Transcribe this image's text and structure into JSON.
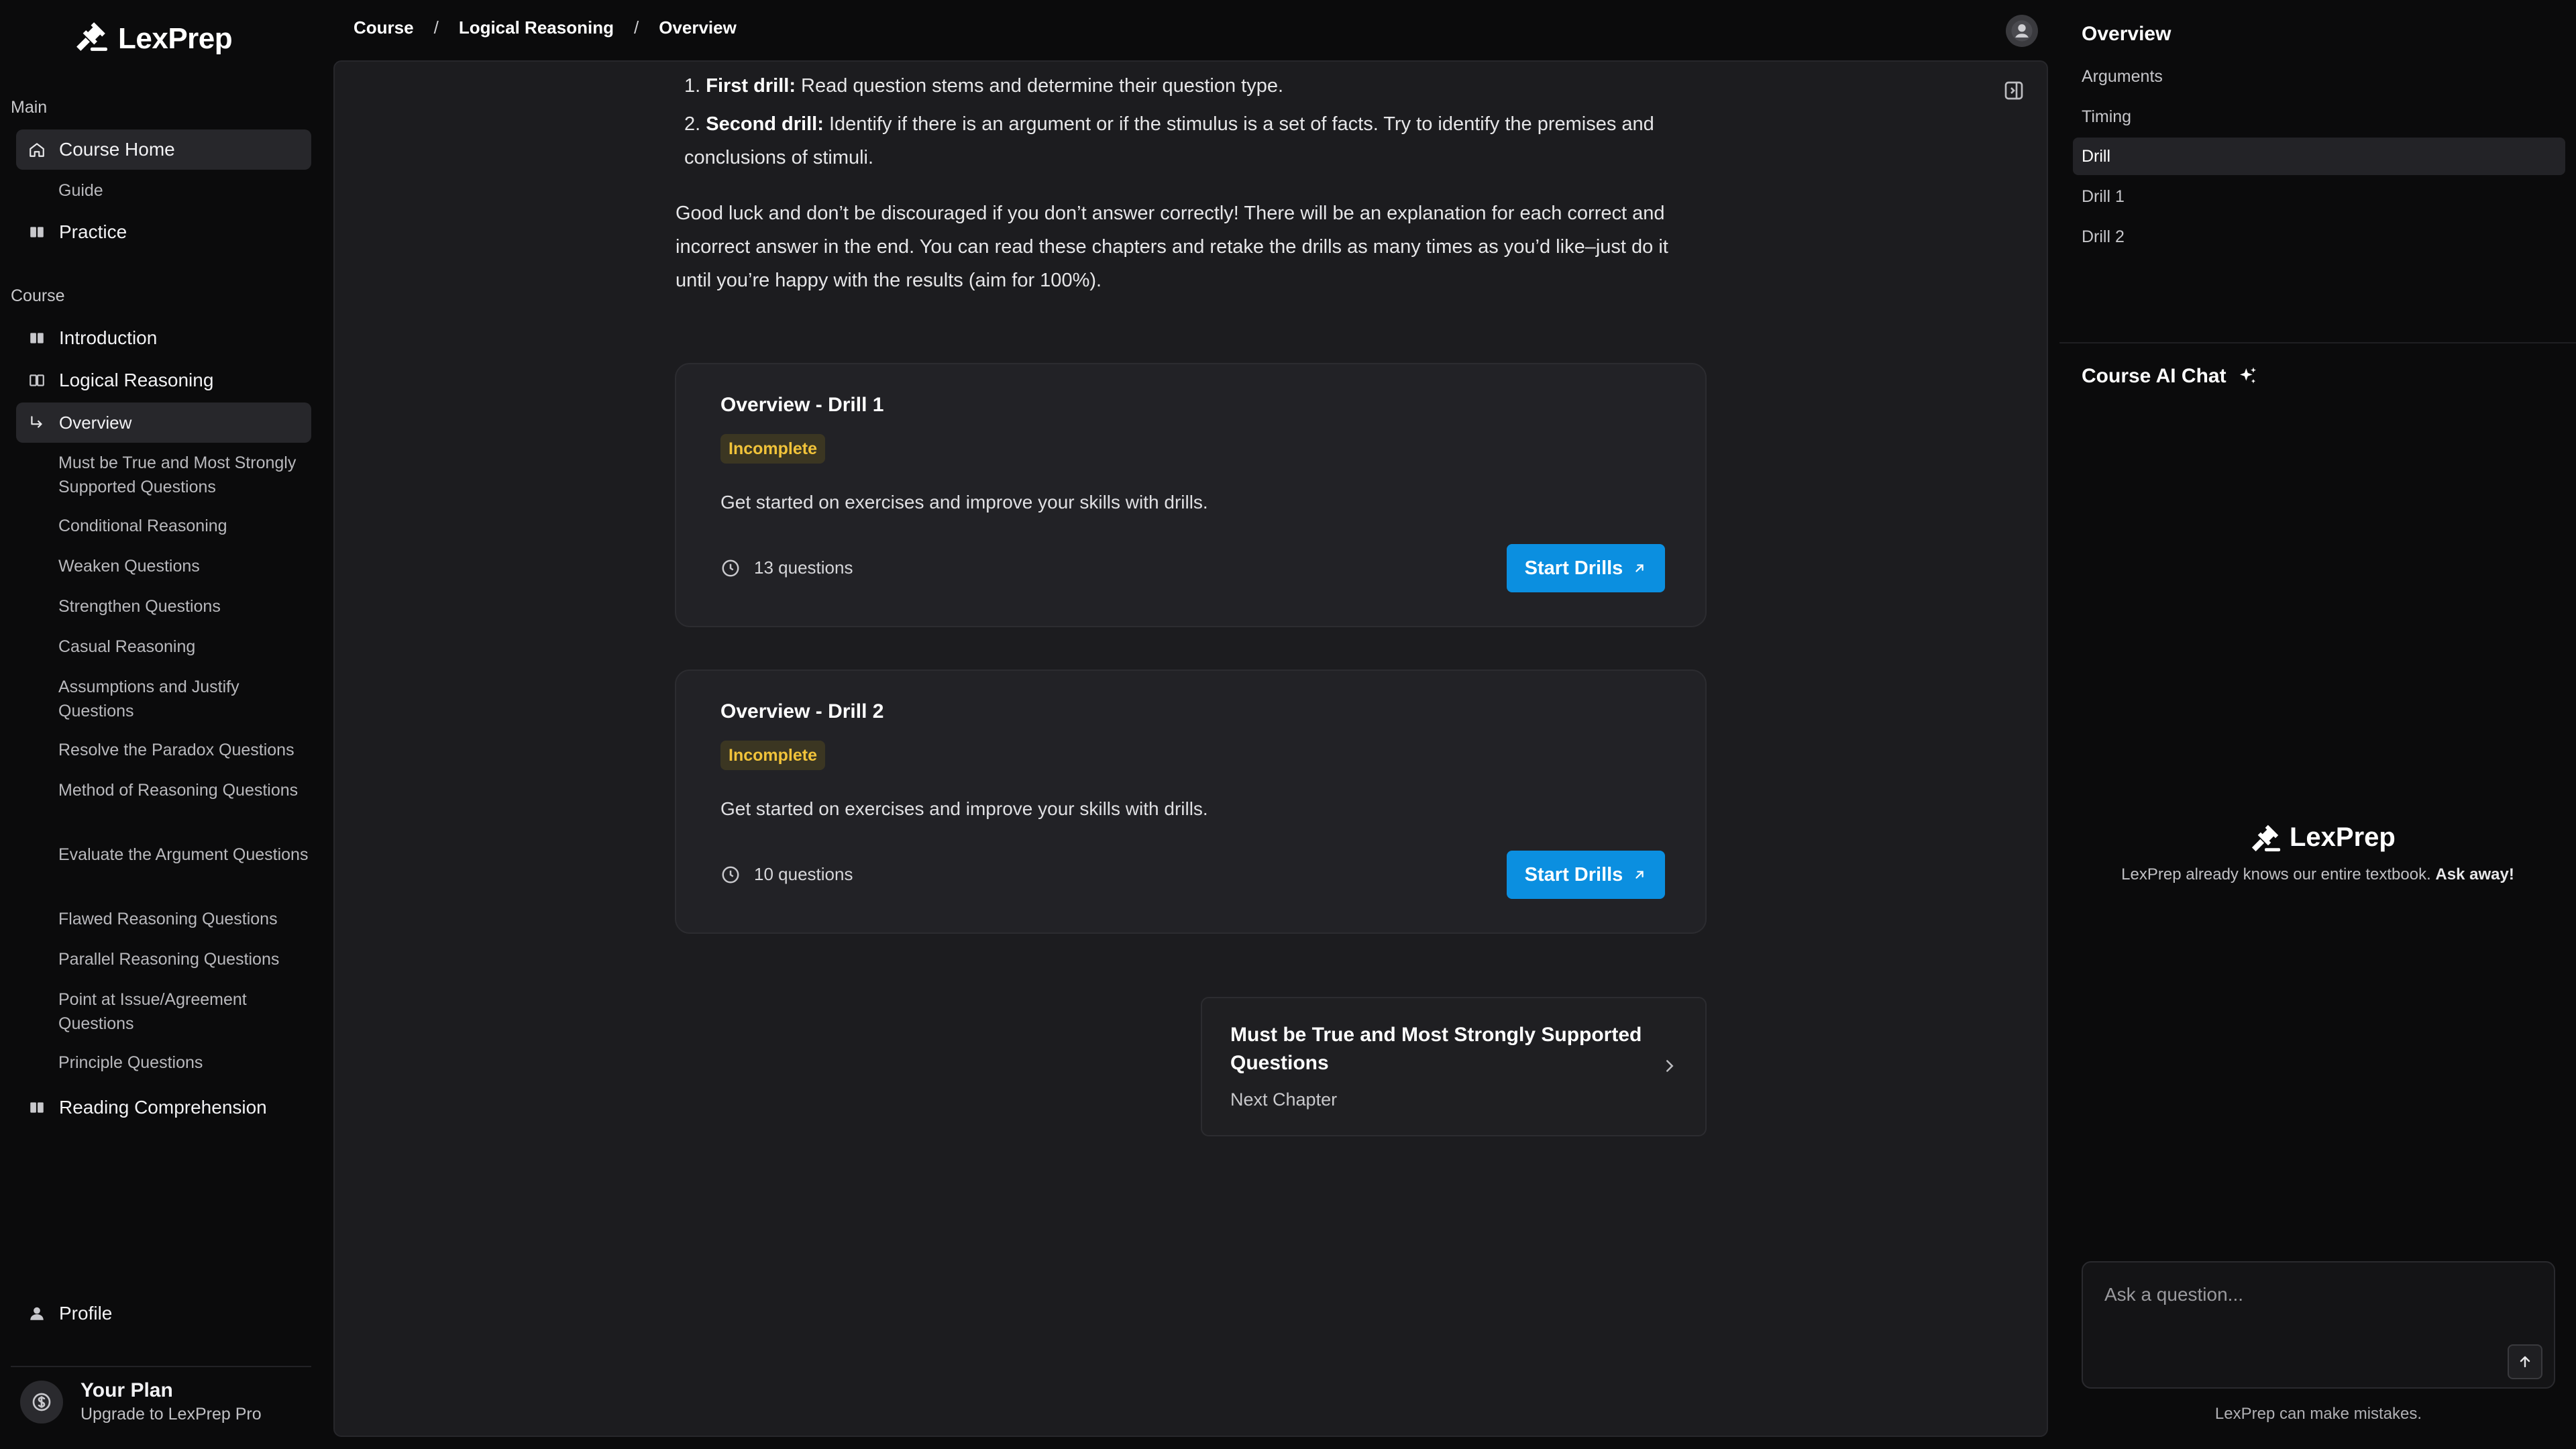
{
  "app": {
    "name": "LexPrep",
    "logo_icon": "gavel-icon"
  },
  "sidebar": {
    "main_label": "Main",
    "course_label": "Course",
    "main_items": [
      {
        "label": "Course Home",
        "icon": "home-icon",
        "active": true
      },
      {
        "label": "Guide"
      },
      {
        "label": "Practice",
        "icon": "book-icon"
      }
    ],
    "course_items": [
      {
        "label": "Introduction",
        "icon": "book-icon"
      },
      {
        "label": "Logical Reasoning",
        "icon": "book-open-icon"
      },
      {
        "label": "Overview",
        "icon": "corner-arrow-icon",
        "active": true
      }
    ],
    "subchapters": [
      "Must be True and Most Strongly Supported Questions",
      "Conditional Reasoning",
      "Weaken Questions",
      "Strengthen Questions",
      "Casual Reasoning",
      "Assumptions and Justify Questions",
      "Resolve the Paradox Questions",
      "Method of Reasoning Questions",
      "Evaluate the Argument Questions",
      "Flawed Reasoning Questions",
      "Parallel Reasoning Questions",
      "Point at Issue/Agreement Questions",
      "Principle Questions"
    ],
    "reading": {
      "label": "Reading Comprehension",
      "icon": "book-icon"
    },
    "profile": {
      "label": "Profile",
      "icon": "user-icon"
    },
    "plan": {
      "title": "Your Plan",
      "subtitle": "Upgrade to LexPrep Pro",
      "icon": "dollar-icon"
    }
  },
  "breadcrumb": {
    "items": [
      "Course",
      "Logical Reasoning",
      "Overview"
    ],
    "separator": "/"
  },
  "main": {
    "list": [
      {
        "num": "1.",
        "bold": "First drill:",
        "text": " Read question stems and determine their question type."
      },
      {
        "num": "2.",
        "bold": "Second drill:",
        "text": " Identify if there is an argument or if the stimulus is a set of facts. Try to identify the premises and conclusions of stimuli."
      }
    ],
    "paragraph": "Good luck and don’t be discouraged if you don’t answer correctly! There will be an explanation for each correct and incorrect answer in the end. You can read these chapters and retake the drills as many times as you’d like–just do it until you’re happy with the results (aim for 100%).",
    "drills": [
      {
        "title": "Overview - Drill 1",
        "status": "Incomplete",
        "description": "Get started on exercises and improve your skills with drills.",
        "questions": "13 questions",
        "button": "Start Drills"
      },
      {
        "title": "Overview - Drill 2",
        "status": "Incomplete",
        "description": "Get started on exercises and improve your skills with drills.",
        "questions": "10 questions",
        "button": "Start Drills"
      }
    ],
    "next_chapter": {
      "title": "Must be True and Most Strongly Supported Questions",
      "label": "Next Chapter"
    }
  },
  "toc": {
    "title": "Overview",
    "items": [
      {
        "label": "Arguments"
      },
      {
        "label": "Timing"
      },
      {
        "label": "Drill",
        "active": true
      },
      {
        "label": "Drill 1"
      },
      {
        "label": "Drill 2"
      }
    ]
  },
  "chat": {
    "title": "Course AI Chat",
    "brand": "LexPrep",
    "hint": "LexPrep already knows our entire textbook.",
    "hint_bold": "Ask away!",
    "placeholder": "Ask a question...",
    "disclaimer": "LexPrep can make mistakes."
  },
  "colors": {
    "accent": "#0b8fe0",
    "badge_text": "#f1c33a",
    "badge_bg": "#3b3622",
    "panel_bg": "#1c1c1f",
    "page_bg": "#0b0b0c"
  }
}
